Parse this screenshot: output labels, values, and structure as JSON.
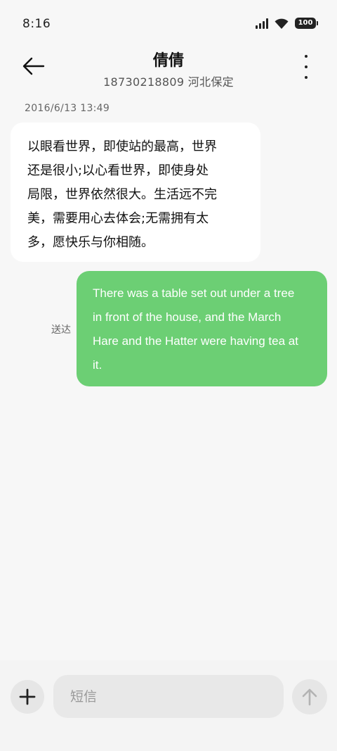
{
  "status_bar": {
    "time": "8:16",
    "battery_level": "100",
    "icons": [
      "signal-icon",
      "wifi-icon",
      "battery-icon"
    ]
  },
  "header": {
    "contact_name": "倩倩",
    "contact_sub": "18730218809 河北保定",
    "back_icon": "arrow-left-icon",
    "more_icon": "more-vertical-icon"
  },
  "conversation": {
    "timestamp": "2016/6/13 13:49",
    "messages": [
      {
        "direction": "incoming",
        "lines": [
          "以眼看世界，即使站的最高，世界",
          "还是很小;以心看世界，即使身处",
          "局限，世界依然很大。生活远不完",
          "美，需要用心去体会;无需拥有太",
          "多，愿快乐与你相随。"
        ]
      },
      {
        "direction": "outgoing",
        "lines": [
          "There was a table set out under a tree",
          "in front of the house, and the March",
          "Hare and the Hatter were having tea at",
          "it."
        ],
        "status": "送达"
      }
    ]
  },
  "composer": {
    "placeholder": "短信",
    "value": "",
    "add_icon": "plus-icon",
    "send_icon": "arrow-up-icon"
  },
  "colors": {
    "background": "#f7f7f7",
    "incoming_bubble": "#ffffff",
    "outgoing_bubble": "#6ccf74",
    "input_background": "#e8e8e8"
  }
}
